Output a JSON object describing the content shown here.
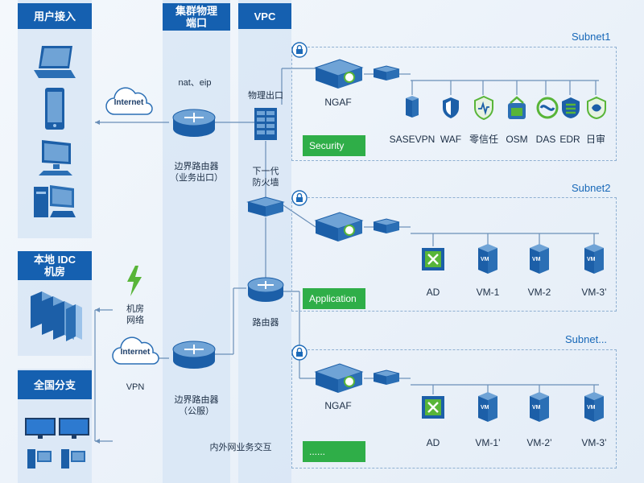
{
  "headers": {
    "user_access": "用户接入",
    "cluster_port": "集群物理\n端口",
    "vpc": "VPC",
    "local_idc": "本地 IDC\n机房",
    "branches": "全国分支"
  },
  "labels": {
    "internet_top": "Internet",
    "internet_bottom": "Internet",
    "nat_eip": "nat、eip",
    "border_router_business": "边界路由器\n（业务出口）",
    "border_router_public": "边界路由器\n（公服）",
    "physical_exit": "物理出口",
    "ngfw": "下一代\n防火墙",
    "router": "路由器",
    "idc_network": "机房\n网络",
    "vpn": "VPN",
    "internal_external": "内外网业务交互"
  },
  "subnets": [
    {
      "title": "Subnet1",
      "gateway_label": "NGAF",
      "zone_label": "Security",
      "nodes": [
        "SASEVPN",
        "WAF",
        "零信任",
        "OSM",
        "DAS",
        "EDR",
        "日审"
      ]
    },
    {
      "title": "Subnet2",
      "gateway_label": "",
      "zone_label": "Application",
      "nodes": [
        "AD",
        "VM-1",
        "VM-2",
        "VM-3’"
      ]
    },
    {
      "title": "Subnet...",
      "gateway_label": "NGAF",
      "zone_label": "......",
      "nodes": [
        "AD",
        "VM-1’",
        "VM-2’",
        "VM-3’"
      ]
    }
  ],
  "colors": {
    "header_blue": "#1560b0",
    "zone_green": "#2fae48",
    "line": "#6a8fb8"
  }
}
